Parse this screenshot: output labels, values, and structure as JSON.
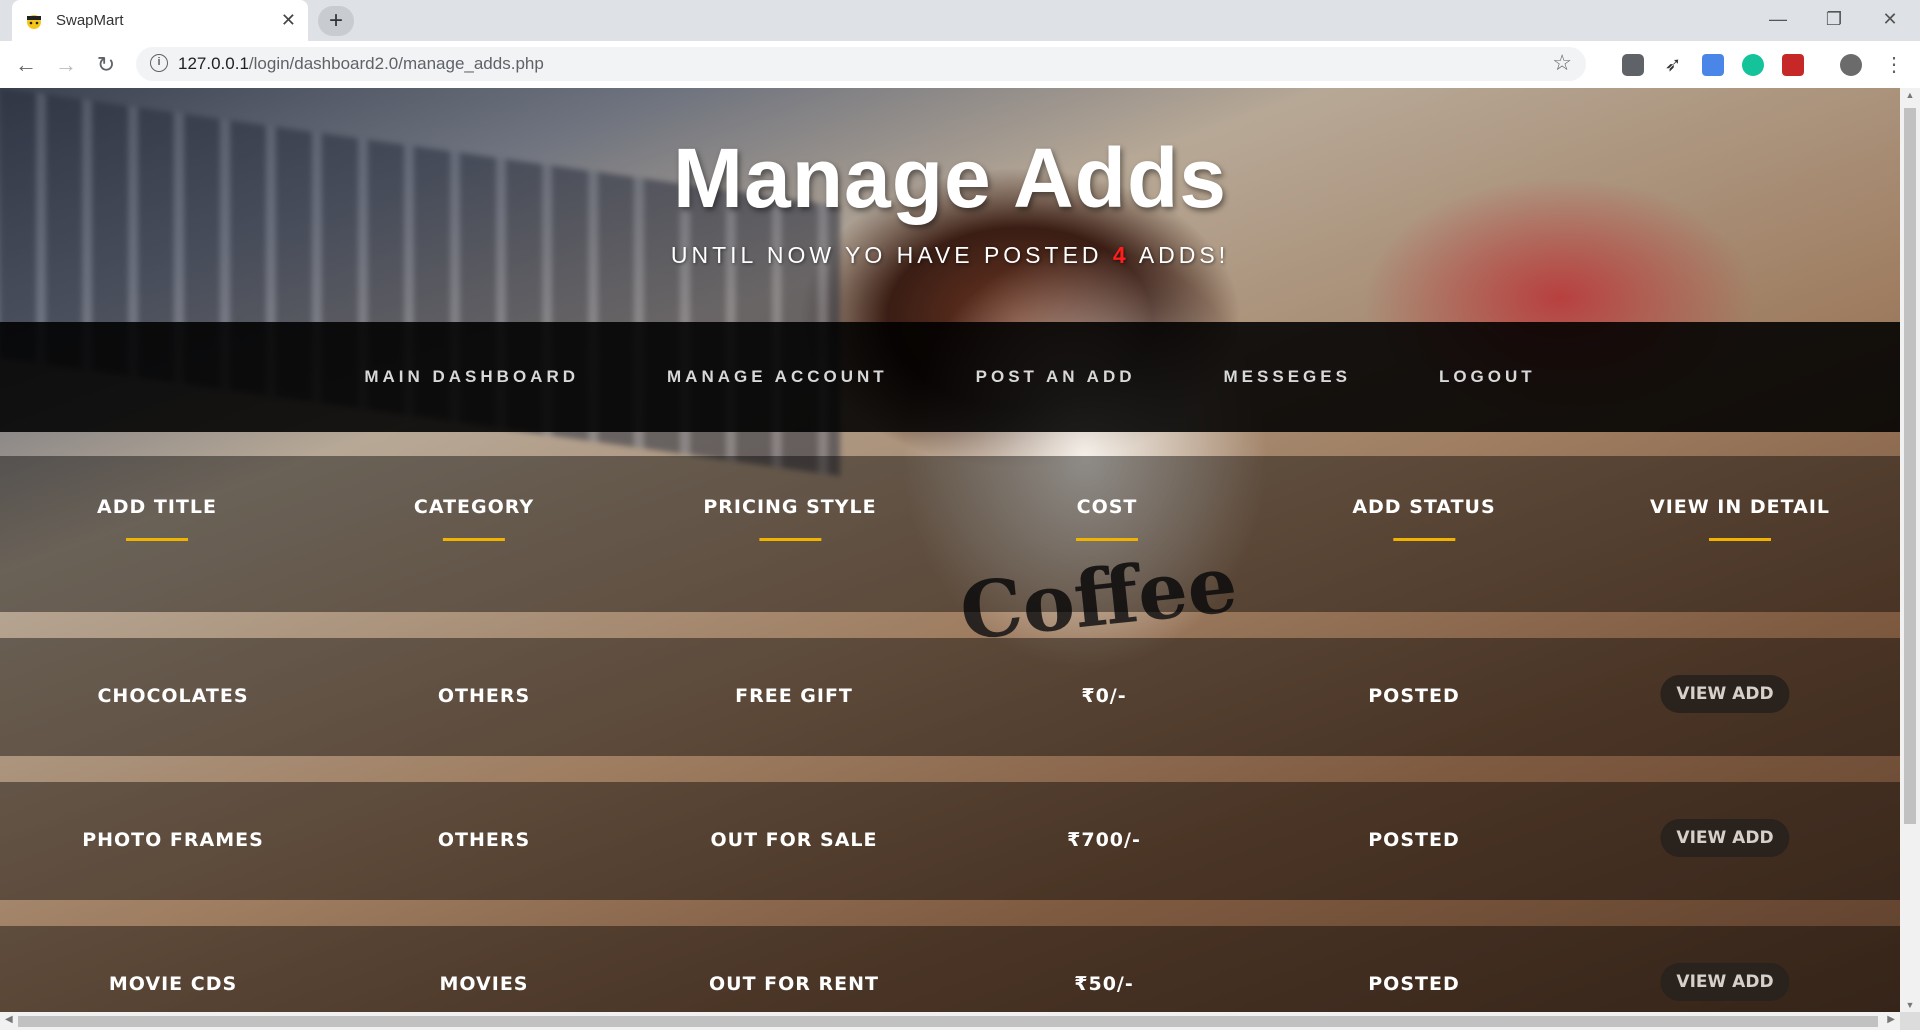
{
  "browser": {
    "tab_title": "SwapMart",
    "close_glyph": "✕",
    "new_tab_glyph": "+",
    "url_host": "127.0.0.1",
    "url_path": "/login/dashboard2.0/manage_adds.php",
    "minimize_glyph": "—",
    "restore_glyph": "❐",
    "close_window_glyph": "✕"
  },
  "hero": {
    "title": "Manage Adds",
    "subtitle_before": "UNTIL NOW YO HAVE POSTED ",
    "count": "4",
    "subtitle_after": " ADDS!"
  },
  "nav": {
    "items": [
      "MAIN DASHBOARD",
      "MANAGE ACCOUNT",
      "POST AN ADD",
      "MESSEGES",
      "LOGOUT"
    ]
  },
  "table": {
    "headers": [
      "ADD TITLE",
      "CATEGORY",
      "PRICING STYLE",
      "COST",
      "ADD STATUS",
      "VIEW IN DETAIL"
    ],
    "rows": [
      {
        "title": "CHOCOLATES",
        "category": "OTHERS",
        "pricing": "FREE GIFT",
        "cost": "₹0/-",
        "status": "POSTED",
        "action": "VIEW ADD"
      },
      {
        "title": "PHOTO FRAMES",
        "category": "OTHERS",
        "pricing": "OUT FOR SALE",
        "cost": "₹700/-",
        "status": "POSTED",
        "action": "VIEW ADD"
      },
      {
        "title": "MOVIE CDS",
        "category": "MOVIES",
        "pricing": "OUT FOR RENT",
        "cost": "₹50/-",
        "status": "POSTED",
        "action": "VIEW ADD"
      }
    ]
  },
  "background": {
    "mug_text": "Coffee"
  },
  "colors": {
    "accent_underline": "#f0b400",
    "count_color": "#ff1e1e",
    "navbar_bg": "#000000"
  },
  "icons": [
    "swapmart-favicon",
    "back-icon",
    "forward-icon",
    "reload-icon",
    "info-icon",
    "star-icon",
    "pocket-icon",
    "rocket-icon",
    "translate-icon",
    "grammarly-icon",
    "bookmark-ext-icon",
    "profile-avatar-icon",
    "menu-icon"
  ]
}
